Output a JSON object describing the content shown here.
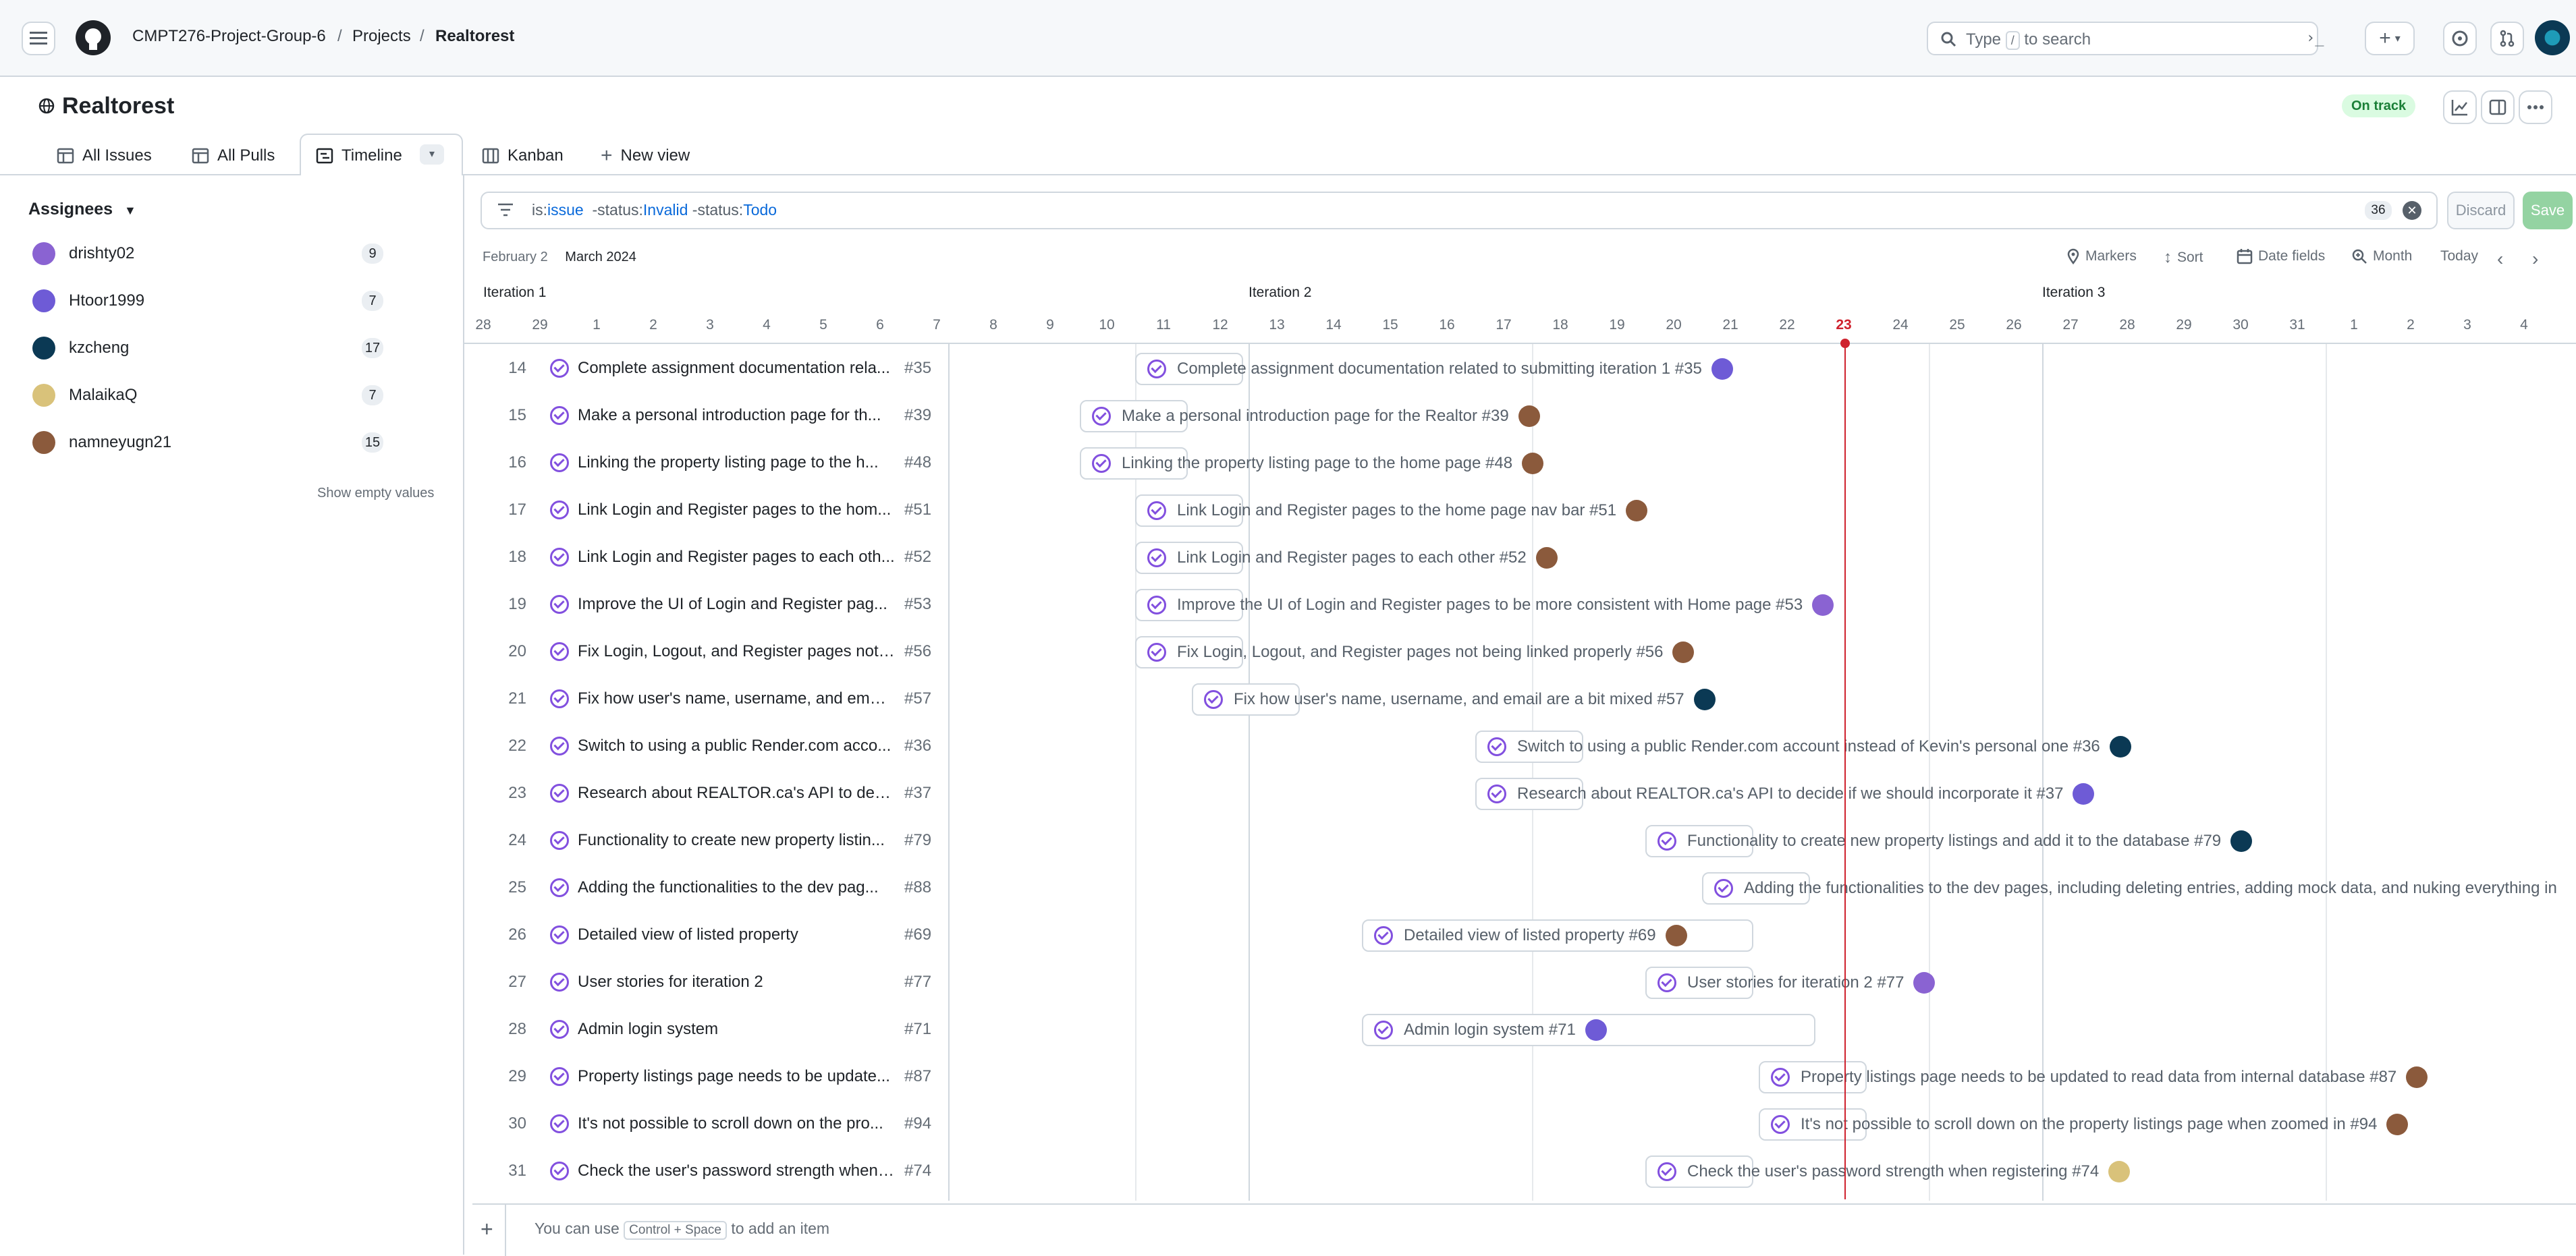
{
  "header": {
    "org": "CMPT276-Project-Group-6",
    "projects": "Projects",
    "repo": "Realtorest",
    "search_type": "Type",
    "search_key": "/",
    "search_rest": "to search",
    "plus_label": "+"
  },
  "project": {
    "title": "Realtorest",
    "status": "On track"
  },
  "tabs": [
    {
      "label": "All Issues"
    },
    {
      "label": "All Pulls"
    },
    {
      "label": "Timeline"
    },
    {
      "label": "Kanban"
    },
    {
      "label": "New view"
    }
  ],
  "sidebar": {
    "heading": "Assignees",
    "assignees": [
      {
        "name": "drishty02",
        "count": "9",
        "color": "#8a63d2"
      },
      {
        "name": "Htoor1999",
        "count": "7",
        "color": "#6e5bd6"
      },
      {
        "name": "kzcheng",
        "count": "17",
        "color": "#0b3954"
      },
      {
        "name": "MalaikaQ",
        "count": "7",
        "color": "#d9c27a"
      },
      {
        "name": "namneyugn21",
        "count": "15",
        "color": "#8b5a3c"
      }
    ],
    "show_empty": "Show empty values"
  },
  "filter": {
    "is": "is:",
    "is_value": "issue",
    "status1": "-status:",
    "status1_value": "Invalid",
    "status2": "-status:",
    "status2_value": "Todo",
    "count": "36",
    "discard": "Discard",
    "save": "Save"
  },
  "timeline": {
    "month_prev": "February 2",
    "month": "March 2024",
    "markers": "Markers",
    "sort": "Sort",
    "date_fields": "Date fields",
    "zoom": "Month",
    "today": "Today",
    "iterations": [
      "Iteration 1",
      "Iteration 2",
      "Iteration 3"
    ],
    "days": [
      "28",
      "29",
      "1",
      "2",
      "3",
      "4",
      "5",
      "6",
      "7",
      "8",
      "9",
      "10",
      "11",
      "12",
      "13",
      "14",
      "15",
      "16",
      "17",
      "18",
      "19",
      "20",
      "21",
      "22",
      "23",
      "24",
      "25",
      "26",
      "27",
      "28",
      "29",
      "30",
      "31",
      "1",
      "2",
      "3",
      "4"
    ],
    "today_day": "23"
  },
  "rows": [
    {
      "num": "14",
      "title": "Complete assignment documentation rela...",
      "ref": "#35",
      "bar": "Complete assignment documentation related to submitting iteration 1 #35",
      "color": "#6e5bd6"
    },
    {
      "num": "15",
      "title": "Make a personal introduction page for th...",
      "ref": "#39",
      "bar": "Make a personal introduction page for the Realtor #39",
      "color": "#8b5a3c"
    },
    {
      "num": "16",
      "title": "Linking the property listing page to the h...",
      "ref": "#48",
      "bar": "Linking the property listing page to the home page #48",
      "color": "#8b5a3c"
    },
    {
      "num": "17",
      "title": "Link Login and Register pages to the hom...",
      "ref": "#51",
      "bar": "Link Login and Register pages to the home page nav bar #51",
      "color": "#8b5a3c"
    },
    {
      "num": "18",
      "title": "Link Login and Register pages to each oth...",
      "ref": "#52",
      "bar": "Link Login and Register pages to each other #52",
      "color": "#8b5a3c"
    },
    {
      "num": "19",
      "title": "Improve the UI of Login and Register pag...",
      "ref": "#53",
      "bar": "Improve the UI of Login and Register pages to be more consistent with Home page #53",
      "color": "#8a63d2"
    },
    {
      "num": "20",
      "title": "Fix Login, Logout, and Register pages not ...",
      "ref": "#56",
      "bar": "Fix Login, Logout, and Register pages not being linked properly #56",
      "color": "#8b5a3c"
    },
    {
      "num": "21",
      "title": "Fix how user's name, username, and email...",
      "ref": "#57",
      "bar": "Fix how user's name, username, and email are a bit mixed #57",
      "color": "#0b3954"
    },
    {
      "num": "22",
      "title": "Switch to using a public Render.com acco...",
      "ref": "#36",
      "bar": "Switch to using a public Render.com account instead of Kevin's personal one #36",
      "color": "#0b3954"
    },
    {
      "num": "23",
      "title": "Research about REALTOR.ca's API to decid...",
      "ref": "#37",
      "bar": "Research about REALTOR.ca's API to decide if we should incorporate it #37",
      "color": "#6e5bd6"
    },
    {
      "num": "24",
      "title": "Functionality to create new property listin...",
      "ref": "#79",
      "bar": "Functionality to create new property listings and add it to the database #79",
      "color": "#0b3954"
    },
    {
      "num": "25",
      "title": "Adding the functionalities to the dev pag...",
      "ref": "#88",
      "bar": "Adding the functionalities to the dev pages, including deleting entries, adding mock data, and nuking everything in",
      "color": ""
    },
    {
      "num": "26",
      "title": "Detailed view of listed property",
      "ref": "#69",
      "bar": "Detailed view of listed property #69",
      "color": "#8b5a3c"
    },
    {
      "num": "27",
      "title": "User stories for iteration 2",
      "ref": "#77",
      "bar": "User stories for iteration 2 #77",
      "color": "#8a63d2"
    },
    {
      "num": "28",
      "title": "Admin login system",
      "ref": "#71",
      "bar": "Admin login system #71",
      "color": "#6e5bd6"
    },
    {
      "num": "29",
      "title": "Property listings page needs to be update...",
      "ref": "#87",
      "bar": "Property listings page needs to be updated to read data from internal database #87",
      "color": "#8b5a3c"
    },
    {
      "num": "30",
      "title": "It's not possible to scroll down on the pro...",
      "ref": "#94",
      "bar": "It's not possible to scroll down on the property listings page when zoomed in #94",
      "color": "#8b5a3c"
    },
    {
      "num": "31",
      "title": "Check the user's password strength when ...",
      "ref": "#74",
      "bar": "Check the user's password strength when registering #74",
      "color": "#d9c27a"
    }
  ],
  "footer": {
    "prefix": "You can use",
    "key": "Control + Space",
    "suffix": "to add an item"
  }
}
